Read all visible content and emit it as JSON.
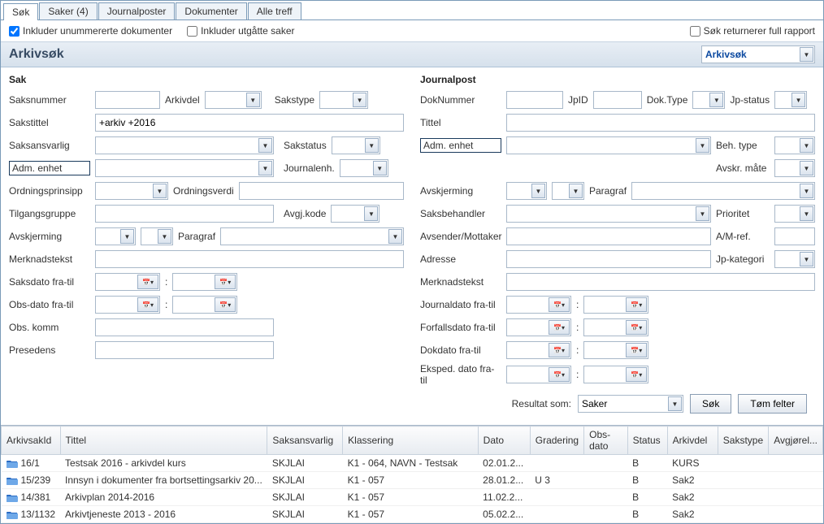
{
  "tabs": {
    "search": "Søk",
    "saker": "Saker (4)",
    "journalposter": "Journalposter",
    "dokumenter": "Dokumenter",
    "alle": "Alle treff"
  },
  "options": {
    "inkluder_unum": "Inkluder unummererte dokumenter",
    "inkluder_utg": "Inkluder utgåtte saker",
    "full_rapport": "Søk returnerer full rapport"
  },
  "header": {
    "title": "Arkivsøk",
    "select_value": "Arkivsøk"
  },
  "sak": {
    "section": "Sak",
    "saksnummer": "Saksnummer",
    "arkivdel": "Arkivdel",
    "sakstype": "Sakstype",
    "sakstittel": "Sakstittel",
    "sakstittel_val": "+arkiv +2016",
    "saksansvarlig": "Saksansvarlig",
    "sakstatus": "Sakstatus",
    "adm_enhet": "Adm. enhet",
    "journalenh": "Journalenh.",
    "ordningsprinsipp": "Ordningsprinsipp",
    "ordningsverdi": "Ordningsverdi",
    "tilgangsgruppe": "Tilgangsgruppe",
    "avgj_kode": "Avgj.kode",
    "avskjerming": "Avskjerming",
    "paragraf": "Paragraf",
    "merknadstekst": "Merknadstekst",
    "saksdato": "Saksdato fra-til",
    "obsdato": "Obs-dato fra-til",
    "obs_komm": "Obs. komm",
    "presedens": "Presedens"
  },
  "jp": {
    "section": "Journalpost",
    "doknummer": "DokNummer",
    "jpid": "JpID",
    "doktype": "Dok.Type",
    "jpstatus": "Jp-status",
    "tittel": "Tittel",
    "adm_enhet": "Adm. enhet",
    "beh_type": "Beh. type",
    "avskr_mate": "Avskr. måte",
    "avskjerming": "Avskjerming",
    "paragraf": "Paragraf",
    "saksbehandler": "Saksbehandler",
    "prioritet": "Prioritet",
    "avsender": "Avsender/Mottaker",
    "am_ref": "A/M-ref.",
    "adresse": "Adresse",
    "jp_kategori": "Jp-kategori",
    "merknadstekst": "Merknadstekst",
    "journaldato": "Journaldato fra-til",
    "forfallsdato": "Forfallsdato fra-til",
    "dokdato": "Dokdato fra-til",
    "ekspeddato": "Eksped. dato fra-til"
  },
  "actions": {
    "resultat_som": "Resultat som:",
    "resultat_val": "Saker",
    "sok": "Søk",
    "tom": "Tøm felter"
  },
  "grid": {
    "headers": {
      "arkivsakid": "ArkivsakId",
      "tittel": "Tittel",
      "saksansvarlig": "Saksansvarlig",
      "klassering": "Klassering",
      "dato": "Dato",
      "gradering": "Gradering",
      "obsdato": "Obs-dato",
      "status": "Status",
      "arkivdel": "Arkivdel",
      "sakstype": "Sakstype",
      "avgj": "Avgjørel..."
    },
    "rows": [
      {
        "id": "16/1",
        "tittel": "Testsak 2016 - arkivdel kurs",
        "ansv": "SKJLAI",
        "klass": "K1 - 064, NAVN - Testsak",
        "dato": "02.01.2...",
        "grad": "",
        "obs": "",
        "status": "B",
        "arkivdel": "KURS",
        "sakstype": ""
      },
      {
        "id": "15/239",
        "tittel": "Innsyn i dokumenter fra bortsettingsarkiv 20...",
        "ansv": "SKJLAI",
        "klass": "K1 - 057",
        "dato": "28.01.2...",
        "grad": "U 3",
        "obs": "",
        "status": "B",
        "arkivdel": "Sak2",
        "sakstype": ""
      },
      {
        "id": "14/381",
        "tittel": "Arkivplan 2014-2016",
        "ansv": "SKJLAI",
        "klass": "K1 - 057",
        "dato": "11.02.2...",
        "grad": "",
        "obs": "",
        "status": "B",
        "arkivdel": "Sak2",
        "sakstype": ""
      },
      {
        "id": "13/1132",
        "tittel": "Arkivtjeneste 2013 - 2016",
        "ansv": "SKJLAI",
        "klass": "K1 - 057",
        "dato": "05.02.2...",
        "grad": "",
        "obs": "",
        "status": "B",
        "arkivdel": "Sak2",
        "sakstype": ""
      }
    ]
  }
}
